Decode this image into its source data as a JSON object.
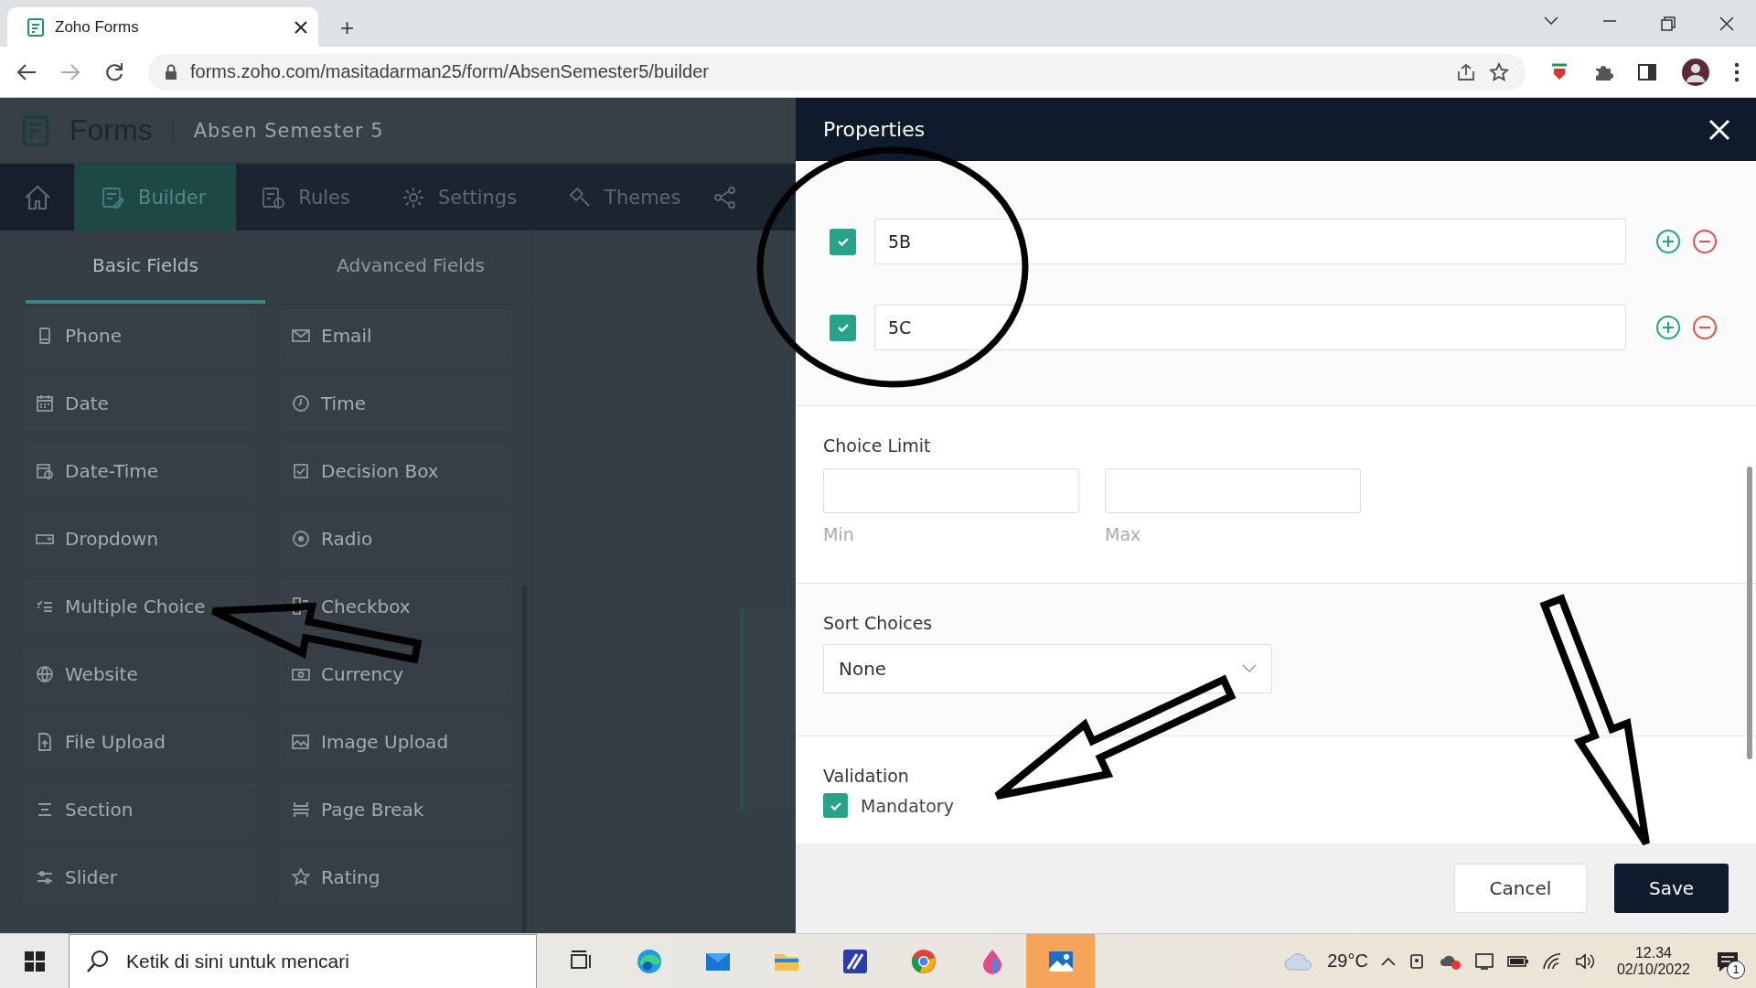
{
  "browser": {
    "tab_title": "Zoho Forms",
    "new_tab": "+",
    "url": "forms.zoho.com/masitadarman25/form/AbsenSemester5/builder"
  },
  "app": {
    "logo": "Forms",
    "form_name": "Absen Semester 5",
    "nav": [
      {
        "label": "Builder",
        "selected": true
      },
      {
        "label": "Rules",
        "selected": false
      },
      {
        "label": "Settings",
        "selected": false
      },
      {
        "label": "Themes",
        "selected": false
      }
    ],
    "field_tabs": [
      {
        "label": "Basic Fields",
        "selected": true
      },
      {
        "label": "Advanced Fields",
        "selected": false
      }
    ],
    "fields": [
      {
        "label": "Phone"
      },
      {
        "label": "Email"
      },
      {
        "label": "Date"
      },
      {
        "label": "Time"
      },
      {
        "label": "Date-Time"
      },
      {
        "label": "Decision Box"
      },
      {
        "label": "Dropdown"
      },
      {
        "label": "Radio"
      },
      {
        "label": "Multiple Choice"
      },
      {
        "label": "Checkbox"
      },
      {
        "label": "Website"
      },
      {
        "label": "Currency"
      },
      {
        "label": "File Upload"
      },
      {
        "label": "Image Upload"
      },
      {
        "label": "Section"
      },
      {
        "label": "Page Break"
      },
      {
        "label": "Slider"
      },
      {
        "label": "Rating"
      }
    ]
  },
  "properties": {
    "title": "Properties",
    "choices": [
      {
        "value": "5B",
        "checked": true
      },
      {
        "value": "5C",
        "checked": true
      }
    ],
    "choice_limit": {
      "label": "Choice Limit",
      "min_label": "Min",
      "max_label": "Max"
    },
    "sort": {
      "label": "Sort Choices",
      "value": "None"
    },
    "validation": {
      "label": "Validation",
      "options": [
        {
          "label": "Mandatory",
          "checked": true
        }
      ]
    },
    "buttons": {
      "cancel": "Cancel",
      "save": "Save"
    }
  },
  "taskbar": {
    "search_placeholder": "Ketik di sini untuk mencari",
    "temperature": "29°C",
    "time": "12.34",
    "date": "02/10/2022",
    "notifications": "1"
  }
}
